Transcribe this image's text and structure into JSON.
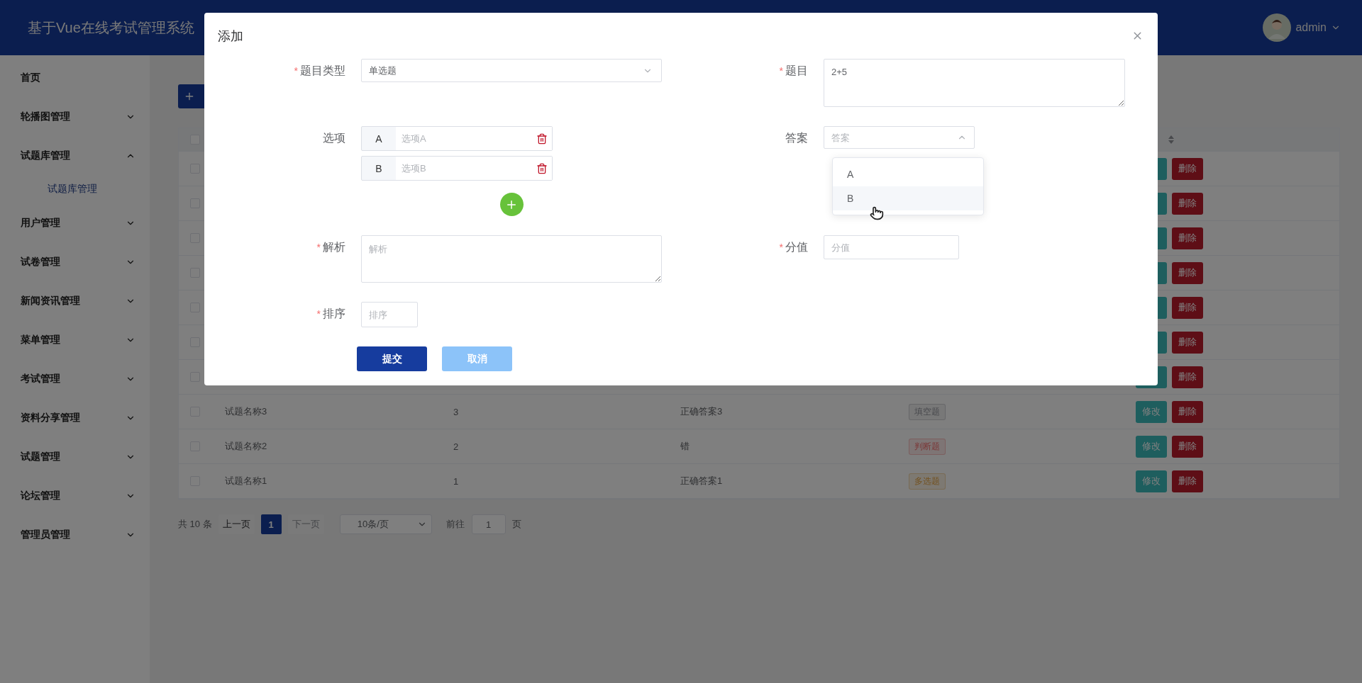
{
  "header": {
    "title": "基于Vue在线考试管理系统",
    "user": "admin"
  },
  "sidebar": {
    "items": [
      {
        "kind": "link",
        "label": "首页"
      },
      {
        "kind": "menu",
        "label": "轮播图管理",
        "expanded": false
      },
      {
        "kind": "menu",
        "label": "试题库管理",
        "expanded": true,
        "children": [
          {
            "label": "试题库管理",
            "selected": true
          }
        ]
      },
      {
        "kind": "menu",
        "label": "用户管理",
        "expanded": false
      },
      {
        "kind": "menu",
        "label": "试卷管理",
        "expanded": false
      },
      {
        "kind": "menu",
        "label": "新闻资讯管理",
        "expanded": false
      },
      {
        "kind": "menu",
        "label": "菜单管理",
        "expanded": false
      },
      {
        "kind": "menu",
        "label": "考试管理",
        "expanded": false
      },
      {
        "kind": "menu",
        "label": "资料分享管理",
        "expanded": false
      },
      {
        "kind": "menu",
        "label": "试题管理",
        "expanded": false
      },
      {
        "kind": "menu",
        "label": "论坛管理",
        "expanded": false
      },
      {
        "kind": "menu",
        "label": "管理员管理",
        "expanded": false
      }
    ]
  },
  "table": {
    "select_all_checked": false,
    "rows": [
      {
        "kind": "covered",
        "checked": false,
        "delete": "删除"
      },
      {
        "kind": "covered",
        "checked": false,
        "delete": "删除"
      },
      {
        "kind": "covered",
        "checked": false,
        "delete": "删除"
      },
      {
        "kind": "covered",
        "checked": false,
        "delete": "删除"
      },
      {
        "kind": "covered",
        "checked": false,
        "delete": "删除"
      },
      {
        "kind": "covered",
        "checked": false,
        "delete": "删除"
      },
      {
        "kind": "covered",
        "checked": false,
        "delete": "删除"
      },
      {
        "kind": "full",
        "checked": false,
        "name": "试题名称3",
        "column_3": "3",
        "column_4": "正确答案3",
        "tag": {
          "label": "填空题",
          "color": "#48494d"
        },
        "edit": "修改",
        "delete": "删除"
      },
      {
        "kind": "full",
        "checked": false,
        "name": "试题名称2",
        "column_3": "2",
        "column_4": "错",
        "tag": {
          "label": "判断题",
          "color": "#7b3636"
        },
        "edit": "修改",
        "delete": "删除"
      },
      {
        "kind": "full",
        "checked": false,
        "name": "试题名称1",
        "column_3": "1",
        "column_4": "正确答案1",
        "tag": {
          "label": "多选题",
          "color": "#73511e"
        },
        "edit": "修改",
        "delete": "删除"
      }
    ]
  },
  "pagination": {
    "total": "共 10 条",
    "prev": {
      "label": "上一页",
      "disabled": false
    },
    "pages": [
      {
        "label": "1",
        "selected": true
      }
    ],
    "next": {
      "label": "下一页",
      "disabled": true
    },
    "page_size": "10条/页",
    "goto_label": "前往",
    "goto_value": "1",
    "goto_suffix": "页"
  },
  "dialog": {
    "title": "添加",
    "question_type": {
      "mark": "*",
      "label": "题目类型",
      "value": "单选题"
    },
    "question": {
      "mark": "*",
      "label": "题目",
      "value": "2+5"
    },
    "options": {
      "label": "选项",
      "items": [
        {
          "letter": "A",
          "placeholder": "选项A"
        },
        {
          "letter": "B",
          "placeholder": "选项B"
        }
      ]
    },
    "answer": {
      "label": "答案",
      "placeholder": "答案",
      "expanded": true,
      "choices": [
        {
          "label": "A",
          "hovered": false
        },
        {
          "label": "B",
          "hovered": true
        }
      ]
    },
    "analysis": {
      "mark": "*",
      "label": "解析",
      "placeholder": "解析"
    },
    "score": {
      "mark": "*",
      "label": "分值",
      "placeholder": "分值"
    },
    "sort": {
      "mark": "*",
      "label": "排序",
      "placeholder": "排序"
    },
    "buttons": [
      {
        "kind": "primary",
        "label": "提交"
      },
      {
        "kind": "light",
        "label": "取消"
      }
    ]
  }
}
